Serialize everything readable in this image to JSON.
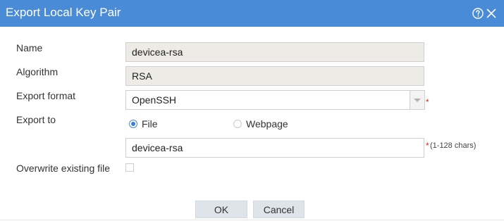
{
  "dialog": {
    "title": "Export Local Key Pair",
    "help_icon": "help-circle-icon",
    "close_icon": "close-icon",
    "titlebar_color": "#4a8bd8"
  },
  "form": {
    "name": {
      "label": "Name",
      "value": "devicea-rsa"
    },
    "algorithm": {
      "label": "Algorithm",
      "value": "RSA"
    },
    "export_format": {
      "label": "Export format",
      "value": "OpenSSH",
      "required_mark": "*"
    },
    "export_to": {
      "label": "Export to",
      "options": [
        {
          "label": "File",
          "selected": true
        },
        {
          "label": "Webpage",
          "selected": false
        }
      ]
    },
    "file_name": {
      "value": "devicea-rsa",
      "required_mark": "*",
      "hint": "(1-128 chars)"
    },
    "overwrite": {
      "label": "Overwrite existing file",
      "checked": false
    }
  },
  "buttons": {
    "ok": "OK",
    "cancel": "Cancel"
  }
}
